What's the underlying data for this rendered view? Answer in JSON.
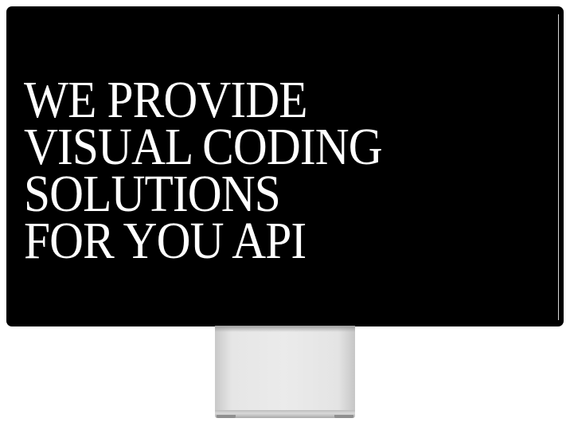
{
  "headline": {
    "lines": [
      "WE PROVIDE",
      "VISUAL CODING",
      "SOLUTIONS",
      "FOR YOU API"
    ]
  },
  "colors": {
    "screen_background": "#000000",
    "headline_text": "#ffffff",
    "page_background": "#ffffff",
    "stand": "#e6e6e6"
  }
}
